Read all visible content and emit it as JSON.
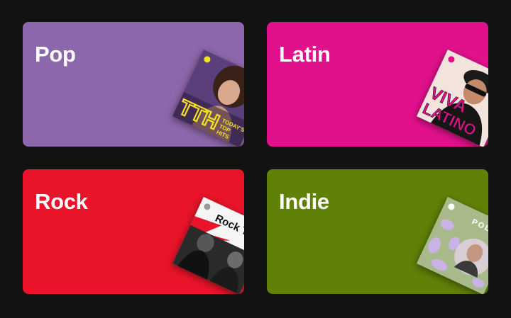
{
  "colors": {
    "background": "#121212",
    "pop": "#8d67ab",
    "latin": "#e1118c",
    "rock": "#e91429",
    "indie": "#608108"
  },
  "cards": [
    {
      "title": "Pop",
      "cover_text": [
        "TODAY'S",
        "TOP",
        "HITS"
      ]
    },
    {
      "title": "Latin",
      "cover_text": [
        "VIVA",
        "LATINO"
      ]
    },
    {
      "title": "Rock",
      "cover_text": [
        "Rock This"
      ]
    },
    {
      "title": "Indie",
      "cover_text": [
        "POLLEN"
      ]
    }
  ]
}
